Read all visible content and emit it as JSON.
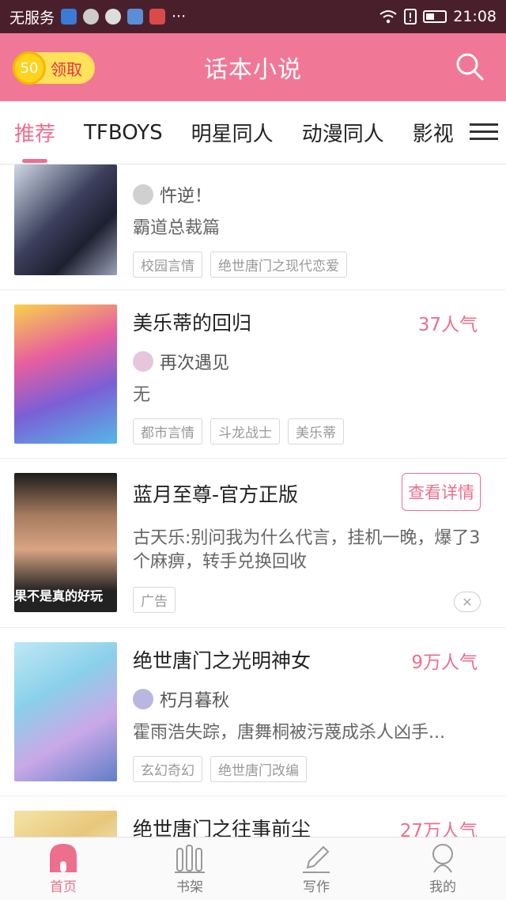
{
  "status_bar": {
    "carrier": "无服务",
    "more": "···",
    "time": "21:08"
  },
  "header": {
    "title": "话本小说",
    "coin_value": "50",
    "claim_label": "领取"
  },
  "tabs": [
    "推荐",
    "TFBOYS",
    "明星同人",
    "动漫同人",
    "影视"
  ],
  "books": [
    {
      "title": "",
      "popularity": "",
      "author": "忤逆！",
      "desc": "霸道总裁篇",
      "tags": [
        "校园言情",
        "绝世唐门之现代恋爱"
      ]
    },
    {
      "title": "美乐蒂的回归",
      "popularity": "37人气",
      "author": "再次遇见",
      "desc": "无",
      "tags": [
        "都市言情",
        "斗龙战士",
        "美乐蒂"
      ]
    },
    {
      "title": "绝世唐门之光明神女",
      "popularity": "9万人气",
      "author": "朽月暮秋",
      "desc": "霍雨浩失踪，唐舞桐被污蔑成杀人凶手...",
      "tags": [
        "玄幻奇幻",
        "绝世唐门改编"
      ]
    },
    {
      "title": "绝世唐门之往事前尘",
      "popularity": "27万人气"
    }
  ],
  "ad": {
    "title": "蓝月至尊-官方正版",
    "button": "查看详情",
    "desc": "古天乐:别问我为什么代言，挂机一晚，爆了3个麻痹，转手兑换回收",
    "label": "广告",
    "caption": "果不是真的好玩"
  },
  "bottom_nav": [
    "首页",
    "书架",
    "写作",
    "我的"
  ],
  "colors": {
    "accent": "#ec6f8d",
    "header": "#f07896",
    "statusbar": "#4a1f2c"
  }
}
